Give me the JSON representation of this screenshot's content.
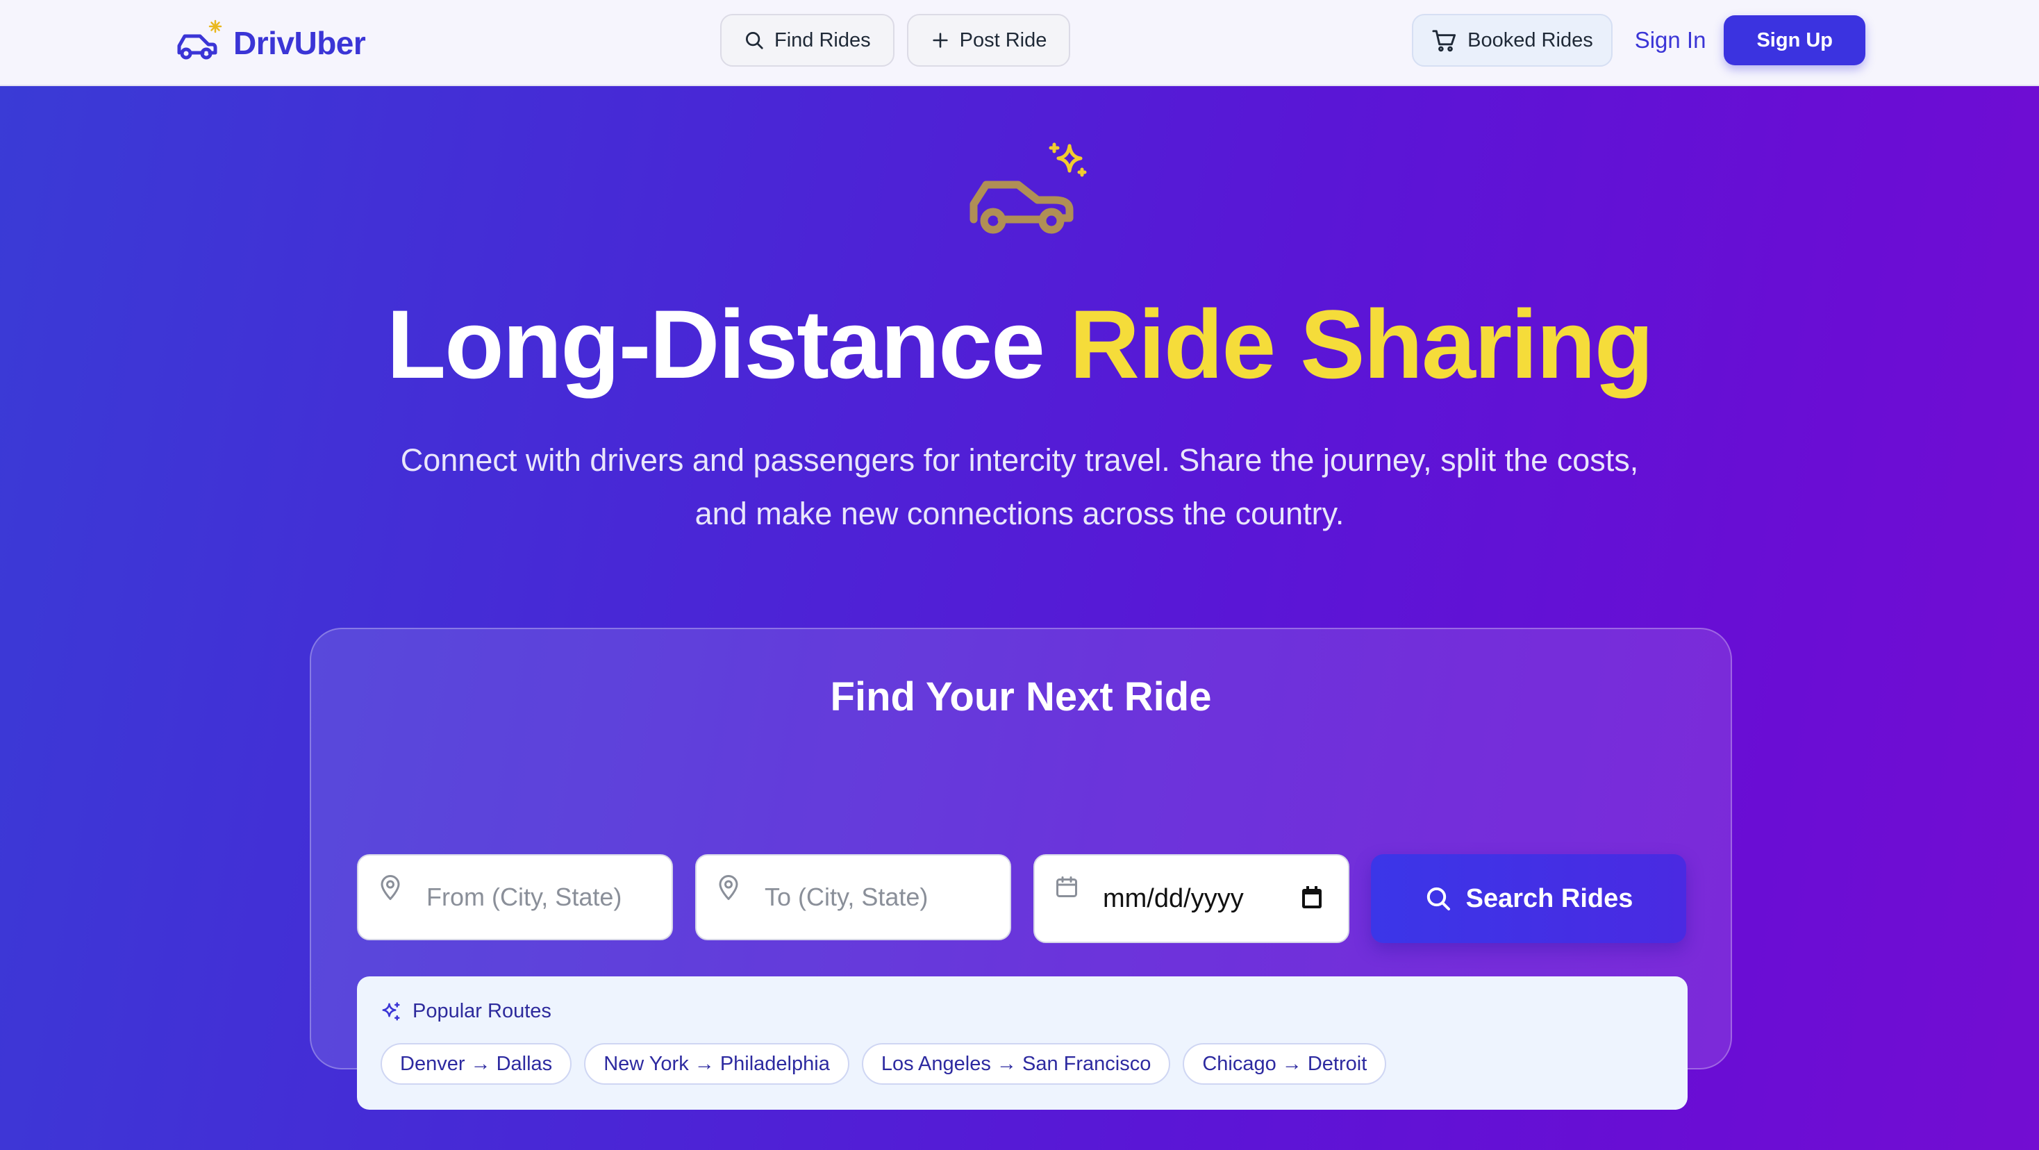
{
  "header": {
    "brand": "DrivUber",
    "nav": [
      {
        "label": "Find Rides",
        "icon": "search-icon"
      },
      {
        "label": "Post Ride",
        "icon": "plus-icon"
      }
    ],
    "booked_label": "Booked Rides",
    "signin_label": "Sign In",
    "signup_label": "Sign Up"
  },
  "hero": {
    "title_main": "Long-Distance ",
    "title_accent": "Ride Sharing",
    "subtitle": "Connect with drivers and passengers for intercity travel. Share the journey, split the costs, and make new connections across the country."
  },
  "search": {
    "title": "Find Your Next Ride",
    "from_placeholder": "From (City, State)",
    "to_placeholder": "To (City, State)",
    "date_placeholder": "mm/dd/yyyy",
    "button_label": "Search Rides"
  },
  "routes": {
    "title": "Popular Routes",
    "items": [
      "Denver → Dallas",
      "New York → Philadelphia",
      "Los Angeles → San Francisco",
      "Chicago → Detroit"
    ]
  },
  "colors": {
    "brand": "#3b35d6",
    "accent_yellow": "#f5dc3a",
    "car_icon": "#b08f55"
  }
}
